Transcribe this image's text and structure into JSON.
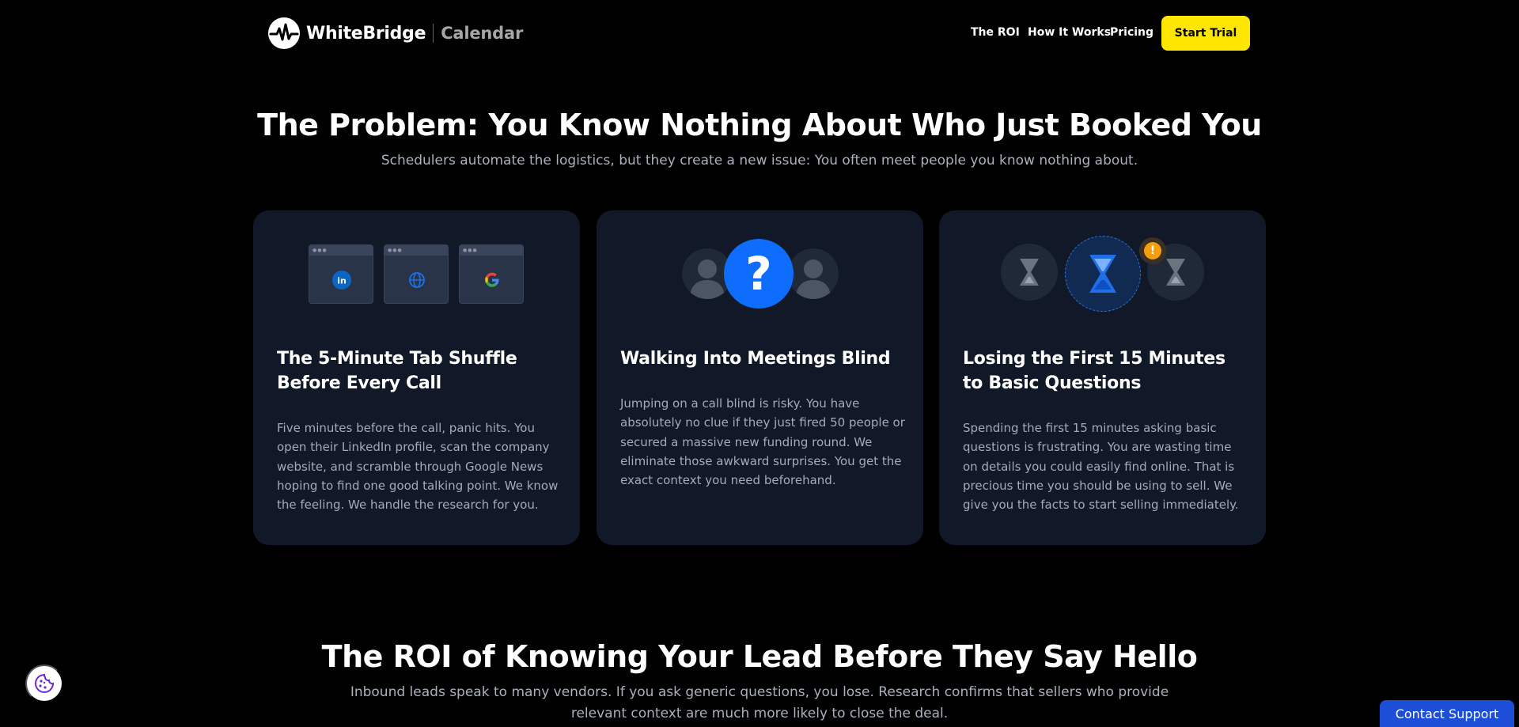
{
  "header": {
    "brand_name": "WhiteBridge",
    "product_name": "Calendar",
    "nav": [
      "The ROI",
      "How It Works",
      "Pricing"
    ],
    "cta_label": "Start Trial"
  },
  "problem": {
    "title": "The Problem: You Know Nothing About Who Just Booked You",
    "subtitle": "Schedulers automate the logistics, but they create a new issue: You often meet people you know nothing about.",
    "cards": [
      {
        "title": "The 5-Minute Tab Shuffle Before Every Call",
        "body": "Five minutes before the call, panic hits. You open their LinkedIn profile, scan the company website, and scramble through Google News hoping to find one good talking point. We know the feeling. We handle the research for you.",
        "icons": [
          "linkedin-icon",
          "globe-icon",
          "google-icon"
        ]
      },
      {
        "title": "Walking Into Meetings Blind",
        "body": "Jumping on a call blind is risky. You have absolutely no clue if they just fired 50 people or secured a massive new funding round. We eliminate those awkward surprises. You get the exact context you need beforehand.",
        "icons": [
          "person-icon",
          "question-mark-icon",
          "person-icon"
        ]
      },
      {
        "title": "Losing the First 15 Minutes to Basic Questions",
        "body": "Spending the first 15 minutes asking basic questions is frustrating. You are wasting time on details you could easily find online. That is precious time you should be using to sell. We give you the facts to start selling immediately.",
        "icons": [
          "hourglass-icon",
          "hourglass-icon",
          "hourglass-icon",
          "alert-icon"
        ],
        "alert_glyph": "!"
      }
    ]
  },
  "roi": {
    "title": "The ROI of Knowing Your Lead Before They Say Hello",
    "subtitle": "Inbound leads speak to many vendors. If you ask generic questions, you lose. Research confirms that sellers who provide relevant context are much more likely to close the deal."
  },
  "question_glyph": "?",
  "support_label": "Contact Support",
  "colors": {
    "background": "#000000",
    "card": "#111827",
    "accent_yellow": "#ffe600",
    "accent_blue": "#0e6dfd",
    "alert_orange": "#f59e0b",
    "support_blue": "#1d4ed8"
  }
}
